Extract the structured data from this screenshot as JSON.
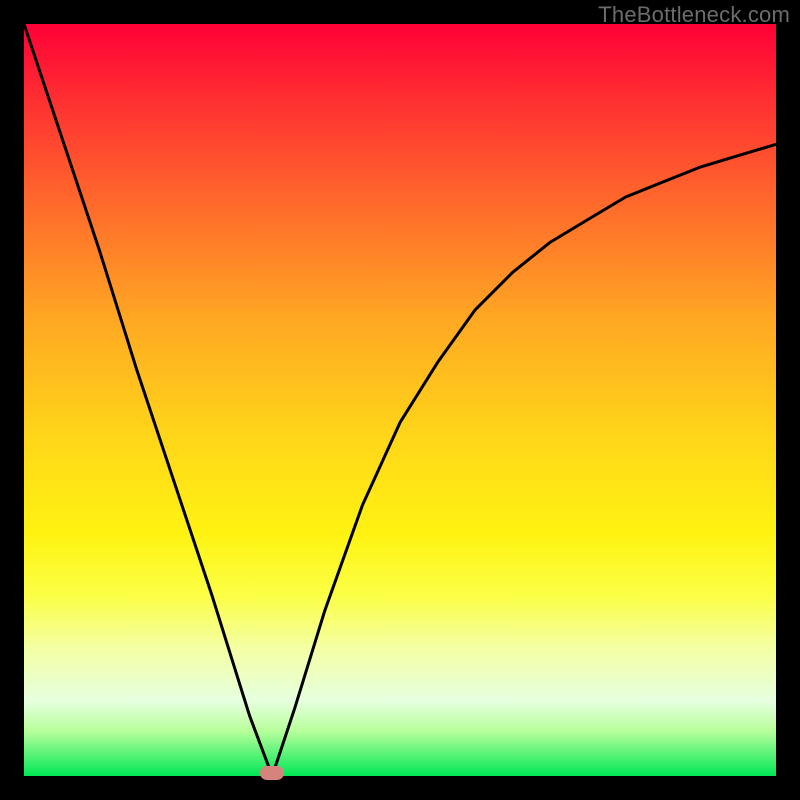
{
  "watermark": "TheBottleneck.com",
  "chart_data": {
    "type": "line",
    "title": "",
    "xlabel": "",
    "ylabel": "",
    "xlim": [
      0,
      100
    ],
    "ylim": [
      0,
      100
    ],
    "grid": false,
    "legend": false,
    "notes": "V-shaped bottleneck curve. Vertical axis runs 100 (top) to 0 (bottom). Minimum at x≈33, y≈0. Left branch rises steeply to top-left corner. Right branch rises with decreasing slope toward upper right.",
    "series": [
      {
        "name": "bottleneck-curve",
        "x": [
          0,
          5,
          10,
          15,
          20,
          25,
          30,
          33,
          36,
          40,
          45,
          50,
          55,
          60,
          65,
          70,
          75,
          80,
          85,
          90,
          95,
          100
        ],
        "y": [
          100,
          85,
          70,
          54,
          39,
          24,
          8,
          0,
          9,
          22,
          36,
          47,
          55,
          62,
          67,
          71,
          74,
          77,
          79,
          81,
          82.5,
          84
        ]
      }
    ],
    "marker": {
      "x": 33,
      "y": 0
    },
    "background_gradient": {
      "top": "#ff0036",
      "bottom": "#00e756"
    }
  }
}
